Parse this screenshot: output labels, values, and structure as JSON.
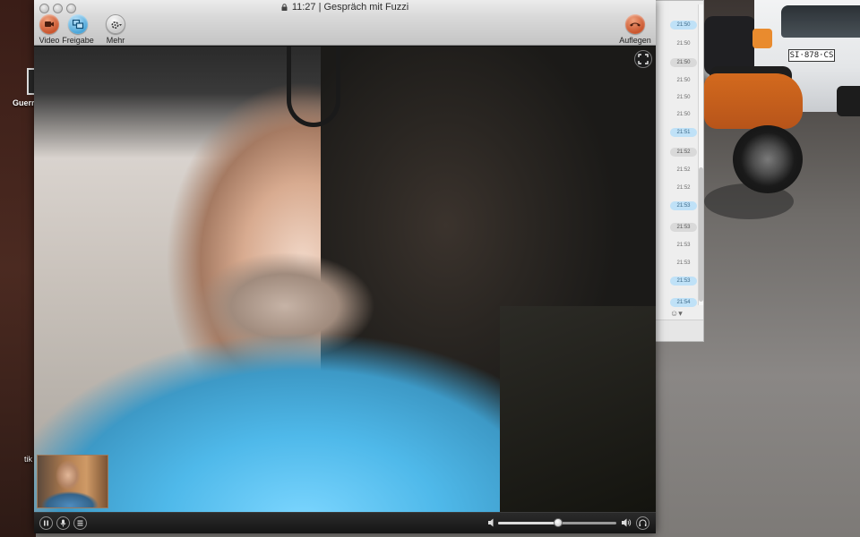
{
  "window": {
    "title": "11:27 | Gespräch mit Fuzzi"
  },
  "toolbar": {
    "video_label": "Video",
    "share_label": "Freigabe",
    "more_label": "Mehr",
    "hangup_label": "Auflegen"
  },
  "chat": {
    "messages": [
      {
        "time": "21:50",
        "style": "blue"
      },
      {
        "time": "21:50",
        "style": "plain"
      },
      {
        "time": "21:50",
        "style": "grey"
      },
      {
        "time": "21:50",
        "style": "plain"
      },
      {
        "time": "21:50",
        "style": "plain"
      },
      {
        "time": "21:50",
        "style": "plain"
      },
      {
        "time": "21:51",
        "style": "blue"
      },
      {
        "time": "21:52",
        "style": "grey"
      },
      {
        "time": "21:52",
        "style": "plain"
      },
      {
        "time": "21:52",
        "style": "plain"
      },
      {
        "time": "21:53",
        "style": "blue"
      },
      {
        "time": "21:53",
        "style": "grey"
      },
      {
        "time": "21:53",
        "style": "plain"
      },
      {
        "time": "21:53",
        "style": "plain"
      },
      {
        "time": "21:53",
        "style": "blue"
      },
      {
        "time": "21:54",
        "style": "blue"
      }
    ],
    "emoji_label": "☺▾"
  },
  "desktop": {
    "icon_label": "Guerra",
    "icon_label_2": "tik"
  },
  "background": {
    "plate_text": "SI·878·CS"
  },
  "controls": {
    "volume_fraction": 0.51
  },
  "colors": {
    "hangup": "#c9552d",
    "share": "#4aa5d8",
    "self_view_border": "#9c7b5f"
  },
  "icons": {
    "video": "video-camera-icon",
    "share": "screen-share-icon",
    "more": "gear-icon",
    "hangup": "phone-hangup-icon",
    "expand": "fullscreen-icon",
    "pause": "pause-icon",
    "mic": "microphone-icon",
    "dialpad": "dialpad-icon",
    "volume_low": "volume-low-icon",
    "volume_high": "volume-high-icon",
    "headset": "headset-icon"
  }
}
